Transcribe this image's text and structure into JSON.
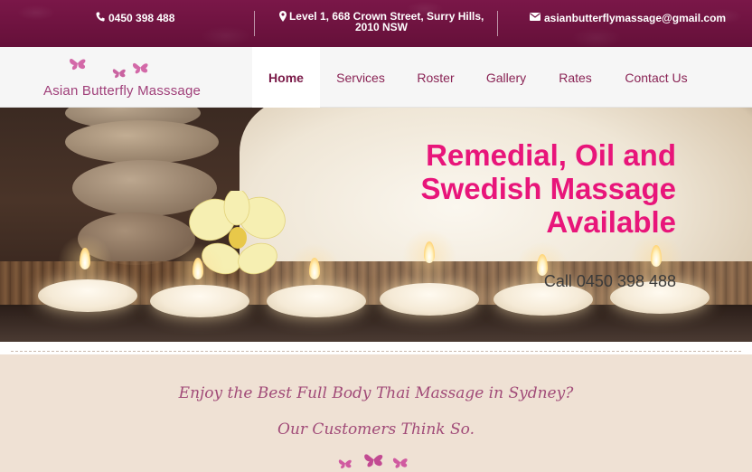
{
  "topbar": {
    "phone": "0450 398 488",
    "address": "Level 1, 668 Crown Street, Surry Hills, 2010 NSW",
    "email": "asianbutterflymassage@gmail.com",
    "background_color": "#6e1140",
    "icons": {
      "phone": "phone-icon",
      "address": "map-marker-icon",
      "email": "envelope-icon"
    }
  },
  "logo": {
    "text": "Asian Butterfly Masssage",
    "icon": "butterfly-icon",
    "color": "#a0407a"
  },
  "nav": {
    "items": [
      {
        "label": "Home",
        "active": true
      },
      {
        "label": "Services",
        "active": false
      },
      {
        "label": "Roster",
        "active": false
      },
      {
        "label": "Gallery",
        "active": false
      },
      {
        "label": "Rates",
        "active": false
      },
      {
        "label": "Contact Us",
        "active": false
      }
    ],
    "text_color": "#8a2455"
  },
  "hero": {
    "title": "Remedial, Oil and Swedish Massage Available",
    "phone_line": "Call 0450 398 488",
    "title_color": "#e8157a"
  },
  "tagline": {
    "line1": "Enjoy the Best Full Body Thai Massage in Sydney?",
    "line2": "Our Customers Think So.",
    "color": "#a14b78",
    "background": "#efe1d4"
  }
}
